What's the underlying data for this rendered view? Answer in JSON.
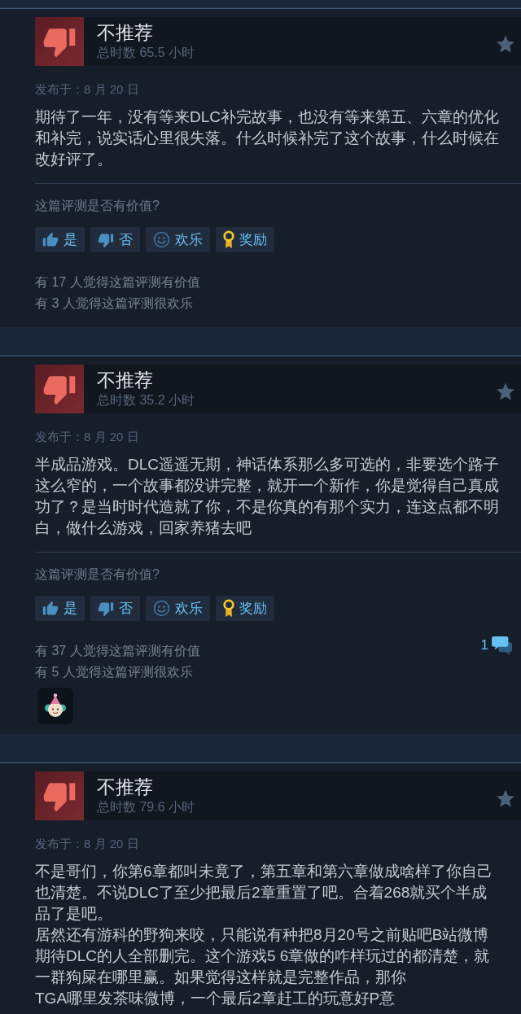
{
  "reviews": [
    {
      "verdict": "不推荐",
      "recommended": false,
      "hours": "总时数 65.5 小时",
      "posted": "发布于：8 月 20 日",
      "body": [
        "期待了一年，没有等来DLC补完故事，也没有等来第五、六章的优化和补完，说实话心里很失落。什么时候补完了这个故事，什么时候在改好评了。"
      ],
      "helpful_prompt": "这篇评测是否有价值?",
      "buttons": [
        {
          "kind": "yes",
          "label": "是"
        },
        {
          "kind": "no",
          "label": "否"
        },
        {
          "kind": "funny",
          "label": "欢乐"
        },
        {
          "kind": "award",
          "label": "奖励"
        }
      ],
      "stats": [
        "有 17 人觉得这篇评测有价值",
        "有 3 人觉得这篇评测很欢乐"
      ],
      "awarded": false
    },
    {
      "verdict": "不推荐",
      "recommended": false,
      "hours": "总时数 35.2 小时",
      "posted": "发布于：8 月 20 日",
      "body": [
        "半成品游戏。DLC遥遥无期，神话体系那么多可选的，非要选个路子这么窄的，一个故事都没讲完整，就开一个新作，你是觉得自己真成功了？是当时时代造就了你，不是你真的有那个实力，连这点都不明白，做什么游戏，回家养猪去吧"
      ],
      "helpful_prompt": "这篇评测是否有价值?",
      "buttons": [
        {
          "kind": "yes",
          "label": "是"
        },
        {
          "kind": "no",
          "label": "否"
        },
        {
          "kind": "funny",
          "label": "欢乐"
        },
        {
          "kind": "award",
          "label": "奖励"
        }
      ],
      "stats": [
        "有 37 人觉得这篇评测有价值",
        "有 5 人觉得这篇评测很欢乐"
      ],
      "comments": "1",
      "awarded": true
    },
    {
      "verdict": "不推荐",
      "recommended": false,
      "hours": "总时数 79.6 小时",
      "posted": "发布于：8 月 20 日",
      "body": [
        "不是哥们，你第6章都叫未竟了，第五章和第六章做成啥样了你自己也清楚。不说DLC了至少把最后2章重置了吧。合着268就买个半成品了是吧。",
        "居然还有游科的野狗来咬，只能说有种把8月20号之前贴吧B站微博期待DLC的人全部删完。这个游戏5 6章做的咋样玩过的都清楚，就一群狗屎在哪里赢。如果觉得这样就是完整作品，那你",
        "TGA哪里发茶味微博，一个最后2章赶工的玩意好P意"
      ],
      "awarded": false
    }
  ]
}
